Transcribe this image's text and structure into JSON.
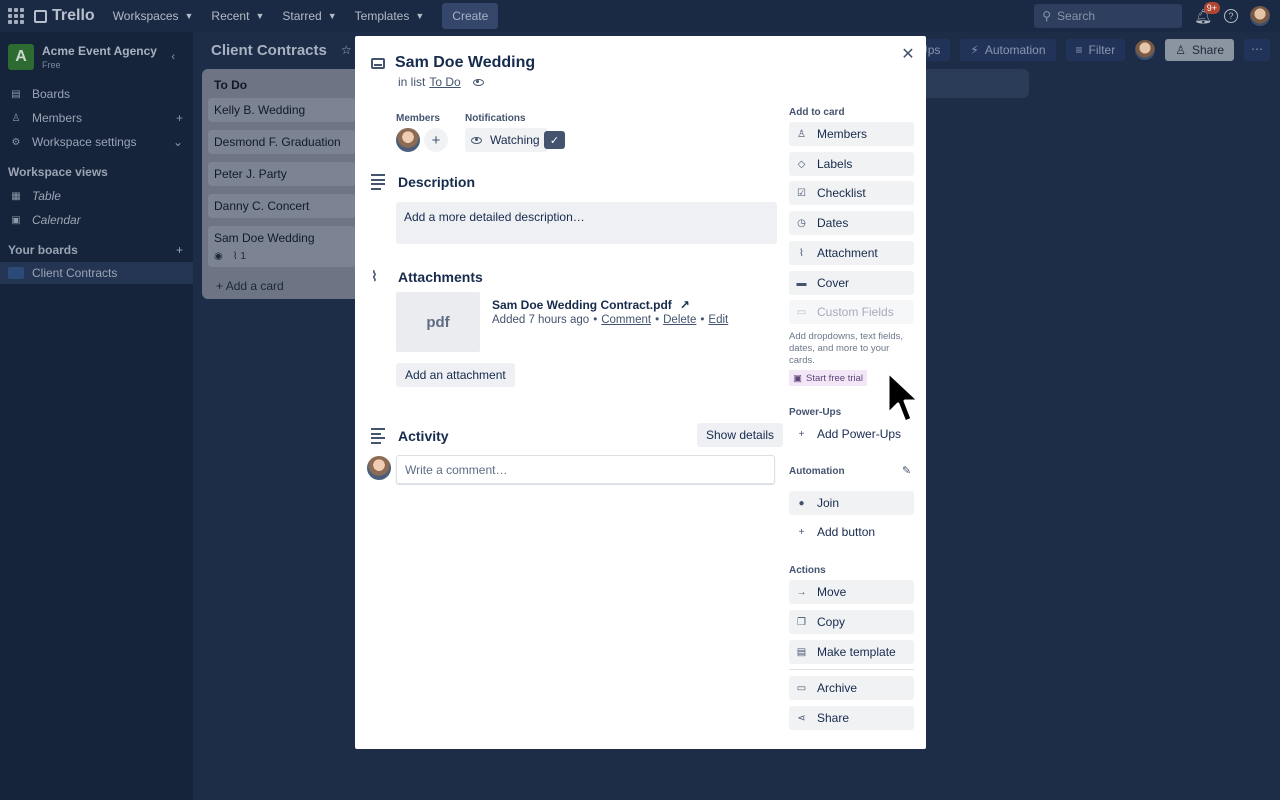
{
  "topbar": {
    "logo": "Trello",
    "nav": [
      "Workspaces",
      "Recent",
      "Starred",
      "Templates"
    ],
    "create": "Create",
    "search_placeholder": "Search",
    "notif_badge": "9+"
  },
  "sidebar": {
    "workspace_initial": "A",
    "workspace_name": "Acme Event Agency",
    "workspace_plan": "Free",
    "items": [
      {
        "label": "Boards"
      },
      {
        "label": "Members"
      },
      {
        "label": "Workspace settings"
      }
    ],
    "views_heading": "Workspace views",
    "views": [
      {
        "label": "Table"
      },
      {
        "label": "Calendar"
      }
    ],
    "boards_heading": "Your boards",
    "boards": [
      {
        "label": "Client Contracts"
      }
    ]
  },
  "board": {
    "title": "Client Contracts",
    "buttons": {
      "powerups": "wer-Ups",
      "automation": "Automation",
      "filter": "Filter",
      "share": "Share"
    }
  },
  "list": {
    "title": "To Do",
    "cards": [
      {
        "title": "Kelly B. Wedding"
      },
      {
        "title": "Desmond F. Graduation"
      },
      {
        "title": "Peter J. Party"
      },
      {
        "title": "Danny C. Concert"
      },
      {
        "title": "Sam Doe Wedding",
        "attachments": "1"
      }
    ],
    "add_card": "Add a card"
  },
  "modal": {
    "title": "Sam Doe Wedding",
    "in_list_prefix": "in list",
    "in_list_name": "To Do",
    "members_label": "Members",
    "notifications_label": "Notifications",
    "watching": "Watching",
    "description_heading": "Description",
    "description_placeholder": "Add a more detailed description…",
    "attachments_heading": "Attachments",
    "attachment": {
      "thumb": "pdf",
      "name": "Sam Doe Wedding Contract.pdf",
      "added": "Added 7 hours ago",
      "comment": "Comment",
      "delete": "Delete",
      "edit": "Edit"
    },
    "add_attachment": "Add an attachment",
    "activity_heading": "Activity",
    "show_details": "Show details",
    "comment_placeholder": "Write a comment…"
  },
  "right": {
    "add_to_card": "Add to card",
    "add_items": [
      {
        "label": "Members",
        "icon": "person-icon"
      },
      {
        "label": "Labels",
        "icon": "tag-icon"
      },
      {
        "label": "Checklist",
        "icon": "checklist-icon"
      },
      {
        "label": "Dates",
        "icon": "clock-icon"
      },
      {
        "label": "Attachment",
        "icon": "paperclip-icon"
      },
      {
        "label": "Cover",
        "icon": "cover-icon"
      }
    ],
    "custom_fields": "Custom Fields",
    "custom_note": "Add dropdowns, text fields, dates, and more to your cards.",
    "start_trial": "Start free trial",
    "powerups_label": "Power-Ups",
    "add_powerups": "Add Power-Ups",
    "automation_label": "Automation",
    "join": "Join",
    "add_button": "Add button",
    "actions_label": "Actions",
    "actions": [
      {
        "label": "Move",
        "icon": "arrow-right-icon"
      },
      {
        "label": "Copy",
        "icon": "copy-icon"
      },
      {
        "label": "Make template",
        "icon": "template-icon"
      }
    ],
    "archive": "Archive",
    "share": "Share"
  }
}
